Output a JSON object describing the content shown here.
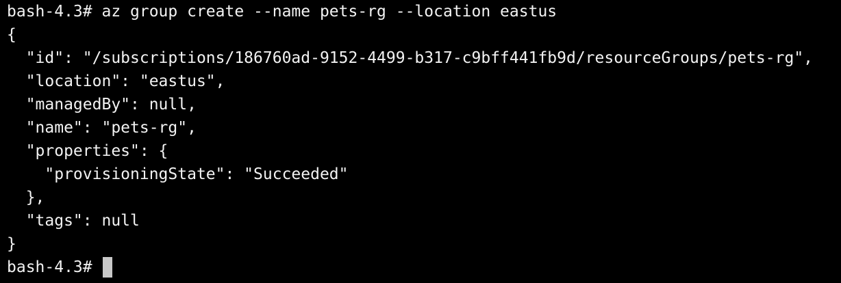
{
  "terminal": {
    "lines": [
      "bash-4.3# az group create --name pets-rg --location eastus",
      "{",
      "  \"id\": \"/subscriptions/186760ad-9152-4499-b317-c9bff441fb9d/resourceGroups/pets-rg\",",
      "  \"location\": \"eastus\",",
      "  \"managedBy\": null,",
      "  \"name\": \"pets-rg\",",
      "  \"properties\": {",
      "    \"provisioningState\": \"Succeeded\"",
      "  },",
      "  \"tags\": null",
      "}"
    ],
    "prompt": "bash-4.3# ",
    "colors": {
      "background": "#000000",
      "foreground": "#f2f2f2",
      "cursor": "#c8c8c8"
    }
  }
}
